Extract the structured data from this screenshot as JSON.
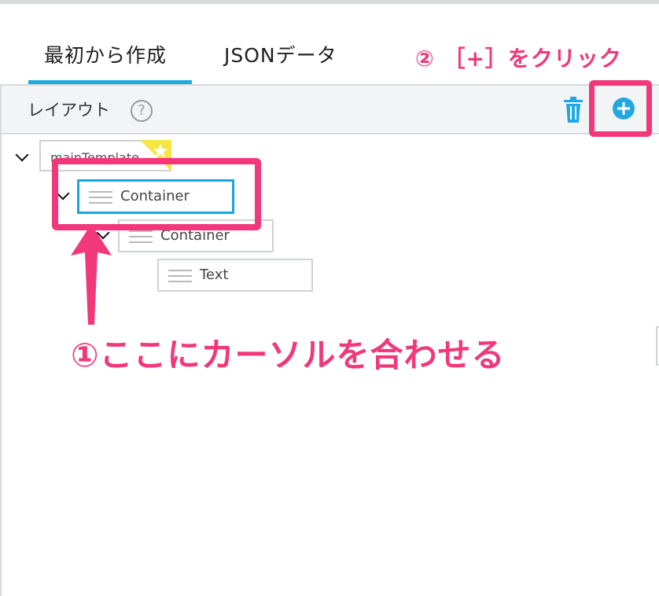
{
  "tabs": [
    {
      "label": "最初から作成",
      "active": true
    },
    {
      "label": "JSONデータ",
      "active": false
    }
  ],
  "header": {
    "title": "レイアウト",
    "help_icon": "question-circle-icon",
    "help_glyph": "?",
    "delete_icon": "trash-icon",
    "add_icon": "plus-circle-icon"
  },
  "tree": {
    "root": {
      "label": "mainTemplate",
      "badge_icon": "star-icon"
    },
    "items": [
      {
        "label": "Container",
        "selected": true
      },
      {
        "label": "Container"
      },
      {
        "label": "Text"
      }
    ]
  },
  "annotations": {
    "step1": "①ここにカーソルを合わせる",
    "step2": "② ［+］をクリック"
  },
  "colors": {
    "accent_blue": "#22a8e1",
    "annotation_pink": "#f0387a",
    "star_yellow": "#f5e642"
  }
}
